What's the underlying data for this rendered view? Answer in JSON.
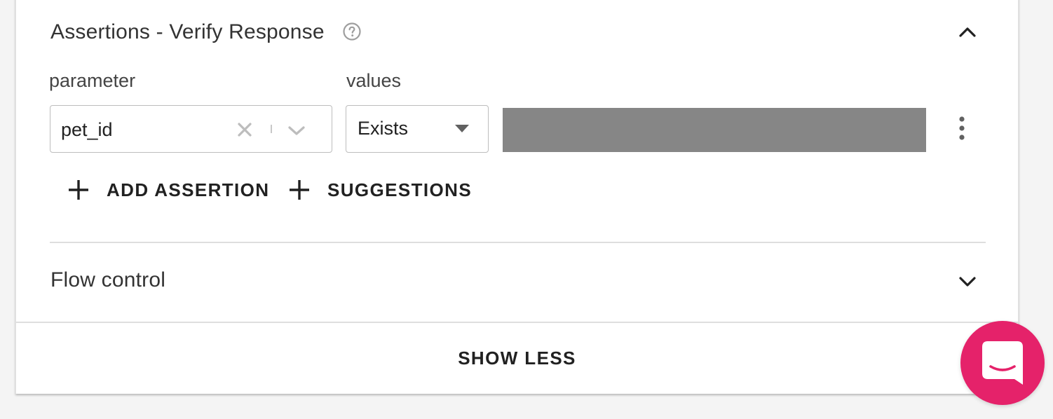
{
  "assertions": {
    "title": "Assertions - Verify Response",
    "parameter_label": "parameter",
    "values_label": "values",
    "parameter_value": "pet_id",
    "values_selected": "Exists",
    "add_assertion_label": "ADD ASSERTION",
    "suggestions_label": "SUGGESTIONS"
  },
  "flow_control": {
    "title": "Flow control"
  },
  "footer": {
    "show_less_label": "SHOW LESS"
  },
  "colors": {
    "chat_launcher": "#e5226a",
    "redacted": "#868686"
  },
  "icons": {
    "help": "question-circle-icon",
    "collapse": "chevron-up-icon",
    "expand": "chevron-down-icon",
    "clear": "close-icon",
    "dropdown": "chevron-down-icon",
    "select_caret": "caret-down-icon",
    "more": "more-vertical-icon",
    "add": "plus-icon",
    "chat": "chat-icon"
  }
}
